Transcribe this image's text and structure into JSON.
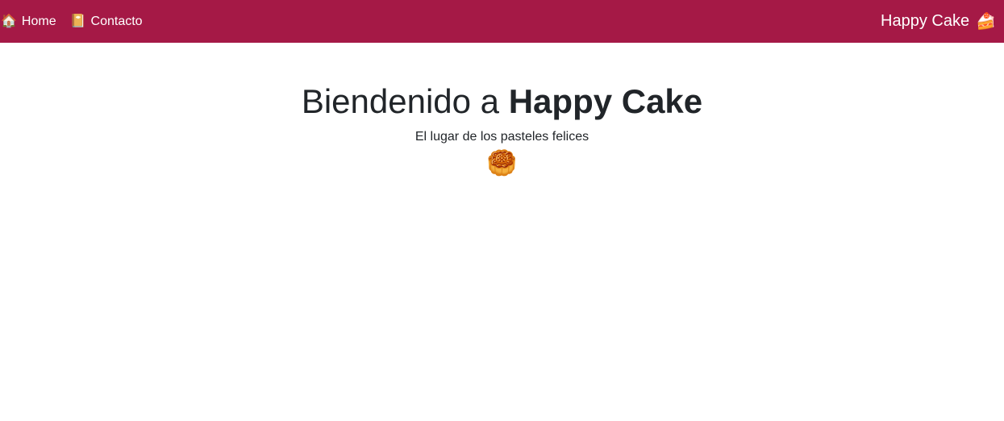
{
  "navbar": {
    "bg_color": "#a51946",
    "links": [
      {
        "icon": "🏠",
        "icon_name": "house-icon",
        "label": "Home"
      },
      {
        "icon": "📔",
        "icon_name": "notebook-icon",
        "label": "Contacto"
      }
    ],
    "brand": {
      "label": "Happy Cake",
      "icon": "🍰",
      "icon_name": "cake-slice-icon"
    }
  },
  "hero": {
    "title_prefix": "Biendenido a ",
    "title_bold": "Happy Cake",
    "subtitle": "El lugar de los pasteles felices",
    "icon": "🥮",
    "icon_name": "mooncake-icon"
  }
}
